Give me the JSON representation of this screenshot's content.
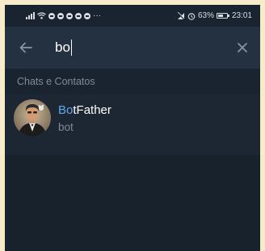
{
  "status_bar": {
    "more_indicator": "···",
    "battery_percent": "63%",
    "battery_level": 0.63,
    "time": "23:01"
  },
  "search": {
    "value": "bo",
    "back_icon": "arrow-left-icon",
    "clear_icon": "close-icon"
  },
  "section": {
    "title": "Chats e Contatos"
  },
  "results": [
    {
      "name_match": "Bo",
      "name_rest": "tFather",
      "subtitle": "bot"
    }
  ],
  "colors": {
    "background": "#1d2733",
    "header": "#243140",
    "highlight": "#62a8e8",
    "secondary_text": "#7e8b98"
  }
}
